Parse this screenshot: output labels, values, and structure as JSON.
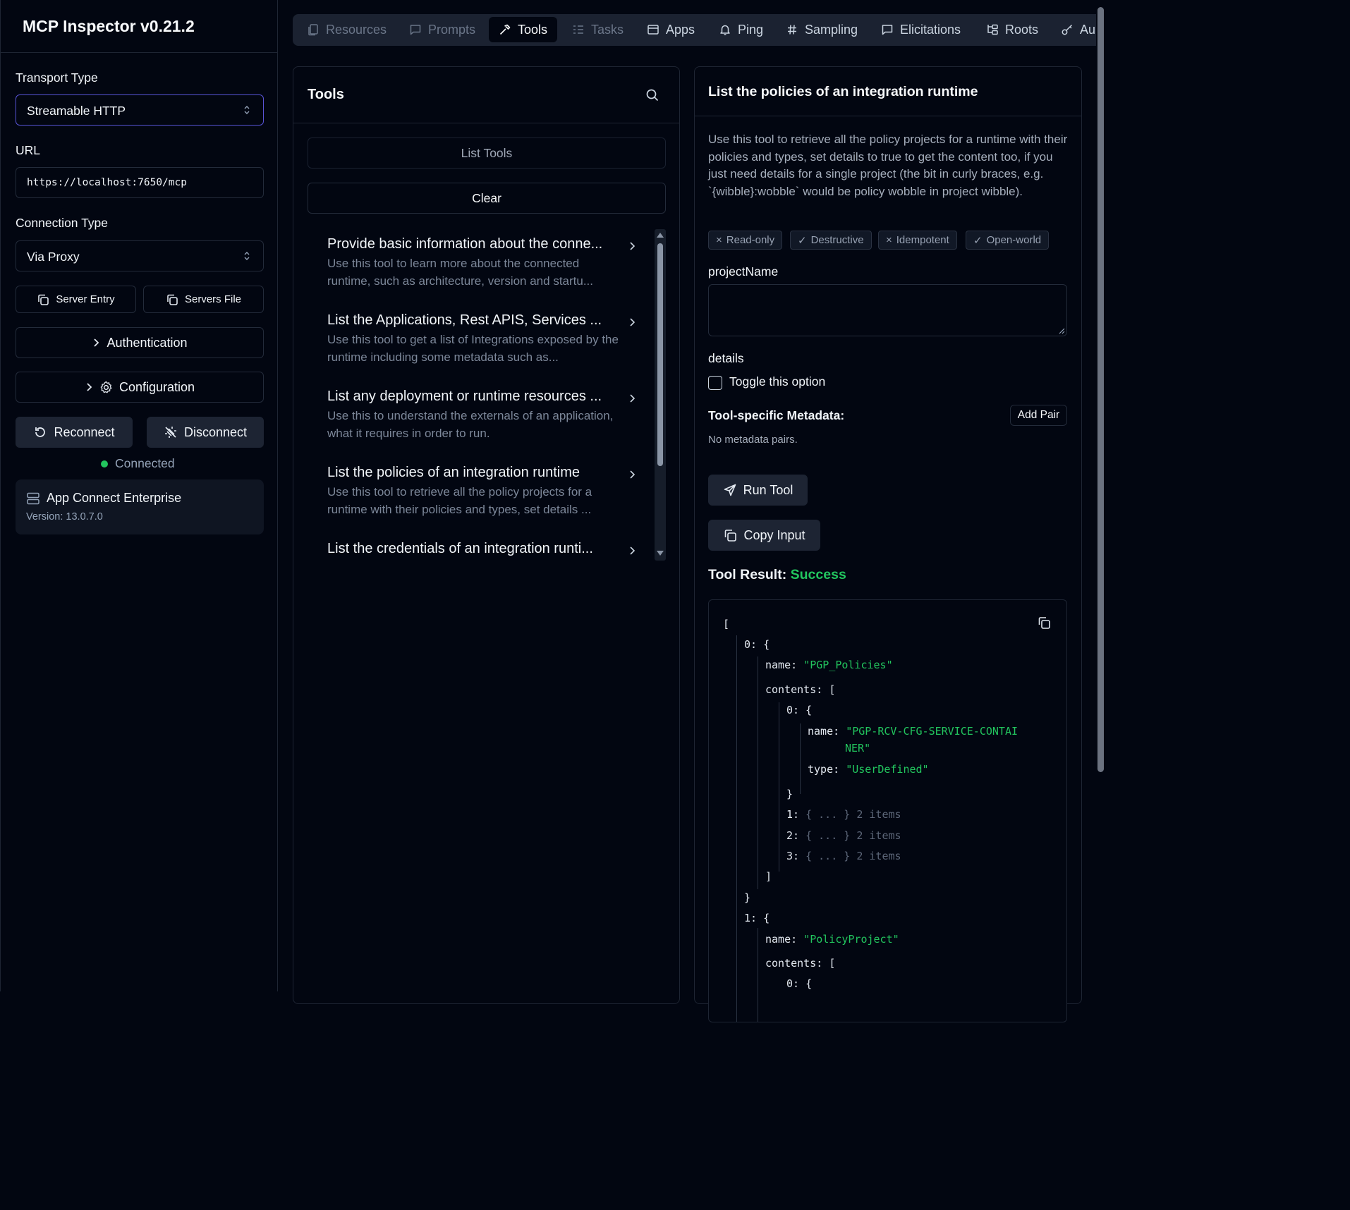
{
  "app": {
    "title": "MCP Inspector v0.21.2"
  },
  "sidebar": {
    "transport_label": "Transport Type",
    "transport_value": "Streamable HTTP",
    "url_label": "URL",
    "url_value": "https://localhost:7650/mcp",
    "connection_label": "Connection Type",
    "connection_value": "Via Proxy",
    "server_entry": "Server Entry",
    "servers_file": "Servers File",
    "authentication": "Authentication",
    "configuration": "Configuration",
    "reconnect": "Reconnect",
    "disconnect": "Disconnect",
    "status": "Connected",
    "server_name": "App Connect Enterprise",
    "server_version": "Version: 13.0.7.0"
  },
  "tabs": [
    {
      "label": "Resources",
      "icon": "file-icon"
    },
    {
      "label": "Prompts",
      "icon": "message-icon"
    },
    {
      "label": "Tools",
      "icon": "hammer-icon"
    },
    {
      "label": "Tasks",
      "icon": "list-check-icon"
    },
    {
      "label": "Apps",
      "icon": "app-window-icon"
    },
    {
      "label": "Ping",
      "icon": "bell-icon"
    },
    {
      "label": "Sampling",
      "icon": "hash-icon"
    },
    {
      "label": "Elicitations",
      "icon": "message-square-icon"
    },
    {
      "label": "Roots",
      "icon": "folder-tree-icon"
    },
    {
      "label": "Au",
      "icon": "key-icon"
    }
  ],
  "tools_panel": {
    "title": "Tools",
    "list_tools": "List Tools",
    "clear": "Clear",
    "items": [
      {
        "title": "Provide basic information about the conne...",
        "desc": "Use this tool to learn more about the connected runtime, such as architecture, version and startu..."
      },
      {
        "title": "List the Applications, Rest APIS, Services ...",
        "desc": "Use this tool to get a list of Integrations exposed by the runtime including some metadata such as..."
      },
      {
        "title": "List any deployment or runtime resources ...",
        "desc": "Use this to understand the externals of an application, what it requires in order to run."
      },
      {
        "title": "List the policies of an integration runtime",
        "desc": "Use this tool to retrieve all the policy projects for a runtime with their policies and types, set details ..."
      },
      {
        "title": "List the credentials of an integration runti...",
        "desc": ""
      }
    ]
  },
  "detail": {
    "title": "List the policies of an integration runtime",
    "description": "Use this tool to retrieve all the policy projects for a runtime with their policies and types, set details to true to get the content too, if you just need details for a single project (the bit in curly braces, e.g. `{wibble}:wobble` would be policy wobble in project wibble).",
    "badges": [
      {
        "mark": "×",
        "label": "Read-only"
      },
      {
        "mark": "✓",
        "label": "Destructive"
      },
      {
        "mark": "×",
        "label": "Idempotent"
      },
      {
        "mark": "✓",
        "label": "Open-world"
      }
    ],
    "project_label": "projectName",
    "details_label": "details",
    "toggle_label": "Toggle this option",
    "meta_label": "Tool-specific Metadata:",
    "add_pair": "Add Pair",
    "no_meta": "No metadata pairs.",
    "run_tool": "Run Tool",
    "copy_input": "Copy Input",
    "result_label": "Tool Result:",
    "result_status": "Success"
  },
  "result_json": {
    "open_bracket": "[",
    "i0_key": "0:",
    "i0_open": "{",
    "name_key": "name:",
    "i0_name": "\"PGP_Policies\"",
    "contents_key": "contents:",
    "contents_open": "[",
    "c0_key": "0:",
    "c0_open": "{",
    "c0_name_line1": "\"PGP-RCV-CFG-SERVICE-CONTAI",
    "c0_name_line2": "NER\"",
    "type_key": "type:",
    "c0_type": "\"UserDefined\"",
    "c0_close": "}",
    "c1_key": "1:",
    "c2_key": "2:",
    "c3_key": "3:",
    "collapsed": "{ ... }",
    "collapsed_count": "2 items",
    "contents_close": "]",
    "i0_close": "}",
    "i1_key": "1:",
    "i1_open": "{",
    "i1_name": "\"PolicyProject\"",
    "i1_contents_open": "[",
    "i1_c0_key": "0:",
    "i1_c0_open": "{"
  },
  "colors": {
    "accent": "#5754d6",
    "success": "#22c55e",
    "string": "#22c55e",
    "background": "#020611"
  }
}
